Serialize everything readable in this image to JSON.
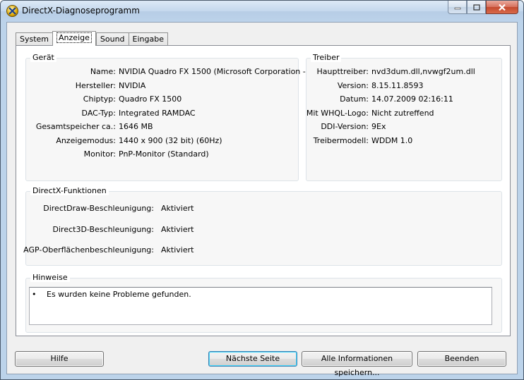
{
  "window": {
    "title": "DirectX-Diagnoseprogramm"
  },
  "tabs": [
    {
      "label": "System"
    },
    {
      "label": "Anzeige"
    },
    {
      "label": "Sound"
    },
    {
      "label": "Eingabe"
    }
  ],
  "device": {
    "label": "Gerät",
    "rows": [
      {
        "key": "Name:",
        "value": "NVIDIA Quadro FX 1500 (Microsoft Corporation -"
      },
      {
        "key": "Hersteller:",
        "value": "NVIDIA"
      },
      {
        "key": "Chiptyp:",
        "value": "Quadro FX 1500"
      },
      {
        "key": "DAC-Typ:",
        "value": "Integrated RAMDAC"
      },
      {
        "key": "Gesamtspeicher ca.:",
        "value": "1646 MB"
      },
      {
        "key": "Anzeigemodus:",
        "value": "1440 x 900 (32 bit) (60Hz)"
      },
      {
        "key": "Monitor:",
        "value": "PnP-Monitor (Standard)"
      }
    ]
  },
  "driver": {
    "label": "Treiber",
    "rows": [
      {
        "key": "Haupttreiber:",
        "value": "nvd3dum.dll,nvwgf2um.dll"
      },
      {
        "key": "Version:",
        "value": "8.15.11.8593"
      },
      {
        "key": "Datum:",
        "value": "14.07.2009 02:16:11"
      },
      {
        "key": "Mit WHQL-Logo:",
        "value": "Nicht zutreffend"
      },
      {
        "key": "DDI-Version:",
        "value": "9Ex"
      },
      {
        "key": "Treibermodell:",
        "value": "WDDM 1.0"
      }
    ]
  },
  "features": {
    "label": "DirectX-Funktionen",
    "rows": [
      {
        "key": "DirectDraw-Beschleunigung:",
        "value": "Aktiviert"
      },
      {
        "key": "Direct3D-Beschleunigung:",
        "value": "Aktiviert"
      },
      {
        "key": "AGP-Oberflächenbeschleunigung:",
        "value": "Aktiviert"
      }
    ]
  },
  "notes": {
    "label": "Hinweise",
    "bullet": "•",
    "items": [
      "Es wurden keine Probleme gefunden."
    ]
  },
  "buttons": {
    "help": "Hilfe",
    "next": "Nächste Seite",
    "save_all": "Alle Informationen speichern...",
    "exit": "Beenden"
  }
}
